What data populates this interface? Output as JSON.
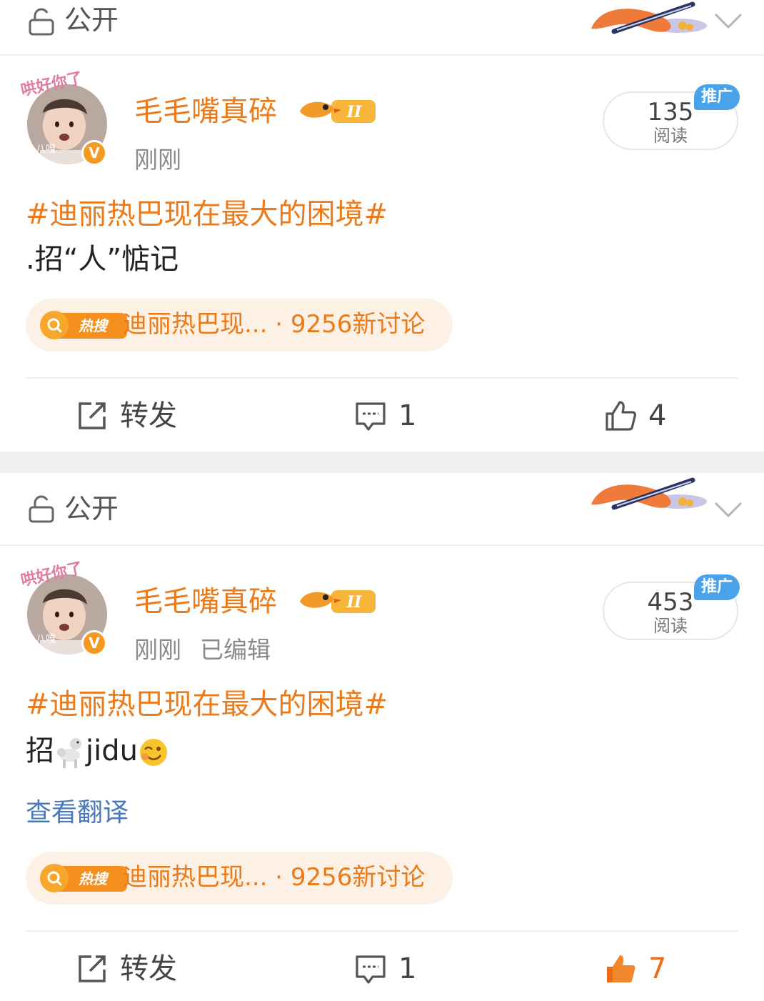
{
  "privacy": {
    "label": "公开"
  },
  "posts": [
    {
      "username": "毛毛嘴真碎",
      "avatar_caption": "哄好你了",
      "avatar_tag": "八嘎",
      "level": "II",
      "time": "刚刚",
      "edited": "",
      "reads": "135",
      "reads_label": "阅读",
      "promo": "推广",
      "topic": "#迪丽热巴现在最大的困境#",
      "text": ".招“人”惦记",
      "hot": {
        "badge": "热搜",
        "text": "迪丽热巴现... · 9256新讨论"
      },
      "actions": {
        "repost": "转发",
        "comments": "1",
        "likes": "4"
      }
    },
    {
      "username": "毛毛嘴真碎",
      "avatar_caption": "哄好你了",
      "avatar_tag": "八嘎",
      "level": "II",
      "time": "刚刚",
      "edited": "已编辑",
      "reads": "453",
      "reads_label": "阅读",
      "promo": "推广",
      "topic": "#迪丽热巴现在最大的困境#",
      "text_before": "招",
      "text_after": "jidu",
      "translate": "查看翻译",
      "hot": {
        "badge": "热搜",
        "text": "迪丽热巴现... · 9256新讨论"
      },
      "actions": {
        "repost": "转发",
        "comments": "1",
        "likes": "7"
      }
    }
  ],
  "colors": {
    "accent": "#eb7a1a",
    "link": "#4b79b8",
    "promo": "#4aa3ea"
  }
}
